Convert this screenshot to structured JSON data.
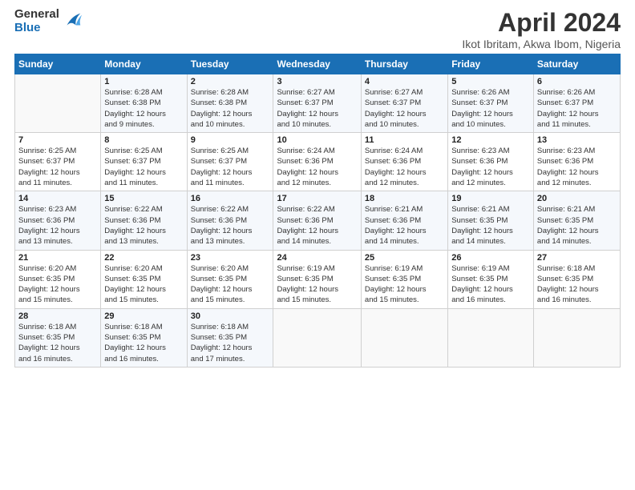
{
  "logo": {
    "general": "General",
    "blue": "Blue"
  },
  "header": {
    "title": "April 2024",
    "subtitle": "Ikot Ibritam, Akwa Ibom, Nigeria"
  },
  "weekdays": [
    "Sunday",
    "Monday",
    "Tuesday",
    "Wednesday",
    "Thursday",
    "Friday",
    "Saturday"
  ],
  "weeks": [
    [
      {
        "day": "",
        "info": ""
      },
      {
        "day": "1",
        "info": "Sunrise: 6:28 AM\nSunset: 6:38 PM\nDaylight: 12 hours\nand 9 minutes."
      },
      {
        "day": "2",
        "info": "Sunrise: 6:28 AM\nSunset: 6:38 PM\nDaylight: 12 hours\nand 10 minutes."
      },
      {
        "day": "3",
        "info": "Sunrise: 6:27 AM\nSunset: 6:37 PM\nDaylight: 12 hours\nand 10 minutes."
      },
      {
        "day": "4",
        "info": "Sunrise: 6:27 AM\nSunset: 6:37 PM\nDaylight: 12 hours\nand 10 minutes."
      },
      {
        "day": "5",
        "info": "Sunrise: 6:26 AM\nSunset: 6:37 PM\nDaylight: 12 hours\nand 10 minutes."
      },
      {
        "day": "6",
        "info": "Sunrise: 6:26 AM\nSunset: 6:37 PM\nDaylight: 12 hours\nand 11 minutes."
      }
    ],
    [
      {
        "day": "7",
        "info": "Sunrise: 6:25 AM\nSunset: 6:37 PM\nDaylight: 12 hours\nand 11 minutes."
      },
      {
        "day": "8",
        "info": "Sunrise: 6:25 AM\nSunset: 6:37 PM\nDaylight: 12 hours\nand 11 minutes."
      },
      {
        "day": "9",
        "info": "Sunrise: 6:25 AM\nSunset: 6:37 PM\nDaylight: 12 hours\nand 11 minutes."
      },
      {
        "day": "10",
        "info": "Sunrise: 6:24 AM\nSunset: 6:36 PM\nDaylight: 12 hours\nand 12 minutes."
      },
      {
        "day": "11",
        "info": "Sunrise: 6:24 AM\nSunset: 6:36 PM\nDaylight: 12 hours\nand 12 minutes."
      },
      {
        "day": "12",
        "info": "Sunrise: 6:23 AM\nSunset: 6:36 PM\nDaylight: 12 hours\nand 12 minutes."
      },
      {
        "day": "13",
        "info": "Sunrise: 6:23 AM\nSunset: 6:36 PM\nDaylight: 12 hours\nand 12 minutes."
      }
    ],
    [
      {
        "day": "14",
        "info": "Sunrise: 6:23 AM\nSunset: 6:36 PM\nDaylight: 12 hours\nand 13 minutes."
      },
      {
        "day": "15",
        "info": "Sunrise: 6:22 AM\nSunset: 6:36 PM\nDaylight: 12 hours\nand 13 minutes."
      },
      {
        "day": "16",
        "info": "Sunrise: 6:22 AM\nSunset: 6:36 PM\nDaylight: 12 hours\nand 13 minutes."
      },
      {
        "day": "17",
        "info": "Sunrise: 6:22 AM\nSunset: 6:36 PM\nDaylight: 12 hours\nand 14 minutes."
      },
      {
        "day": "18",
        "info": "Sunrise: 6:21 AM\nSunset: 6:36 PM\nDaylight: 12 hours\nand 14 minutes."
      },
      {
        "day": "19",
        "info": "Sunrise: 6:21 AM\nSunset: 6:35 PM\nDaylight: 12 hours\nand 14 minutes."
      },
      {
        "day": "20",
        "info": "Sunrise: 6:21 AM\nSunset: 6:35 PM\nDaylight: 12 hours\nand 14 minutes."
      }
    ],
    [
      {
        "day": "21",
        "info": "Sunrise: 6:20 AM\nSunset: 6:35 PM\nDaylight: 12 hours\nand 15 minutes."
      },
      {
        "day": "22",
        "info": "Sunrise: 6:20 AM\nSunset: 6:35 PM\nDaylight: 12 hours\nand 15 minutes."
      },
      {
        "day": "23",
        "info": "Sunrise: 6:20 AM\nSunset: 6:35 PM\nDaylight: 12 hours\nand 15 minutes."
      },
      {
        "day": "24",
        "info": "Sunrise: 6:19 AM\nSunset: 6:35 PM\nDaylight: 12 hours\nand 15 minutes."
      },
      {
        "day": "25",
        "info": "Sunrise: 6:19 AM\nSunset: 6:35 PM\nDaylight: 12 hours\nand 15 minutes."
      },
      {
        "day": "26",
        "info": "Sunrise: 6:19 AM\nSunset: 6:35 PM\nDaylight: 12 hours\nand 16 minutes."
      },
      {
        "day": "27",
        "info": "Sunrise: 6:18 AM\nSunset: 6:35 PM\nDaylight: 12 hours\nand 16 minutes."
      }
    ],
    [
      {
        "day": "28",
        "info": "Sunrise: 6:18 AM\nSunset: 6:35 PM\nDaylight: 12 hours\nand 16 minutes."
      },
      {
        "day": "29",
        "info": "Sunrise: 6:18 AM\nSunset: 6:35 PM\nDaylight: 12 hours\nand 16 minutes."
      },
      {
        "day": "30",
        "info": "Sunrise: 6:18 AM\nSunset: 6:35 PM\nDaylight: 12 hours\nand 17 minutes."
      },
      {
        "day": "",
        "info": ""
      },
      {
        "day": "",
        "info": ""
      },
      {
        "day": "",
        "info": ""
      },
      {
        "day": "",
        "info": ""
      }
    ]
  ]
}
